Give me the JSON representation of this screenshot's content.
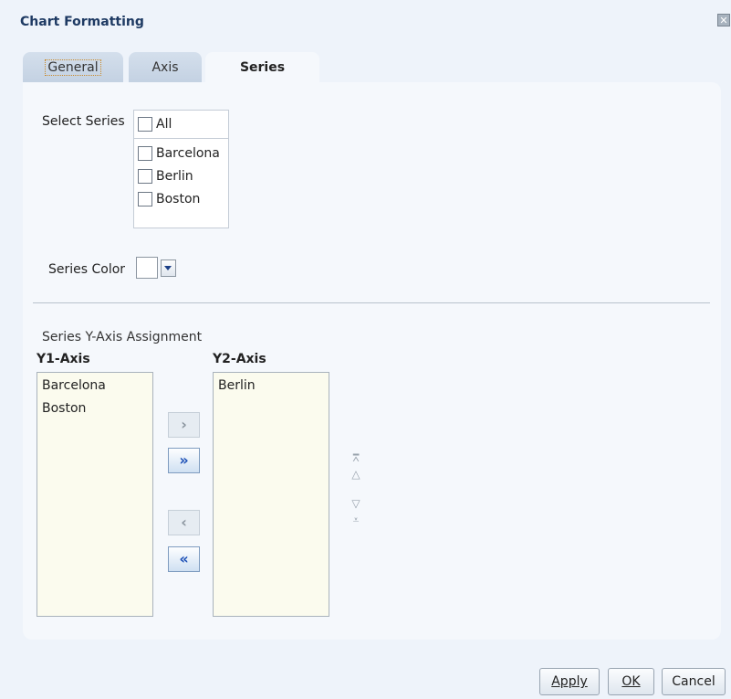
{
  "dialog": {
    "title": "Chart Formatting",
    "close_glyph": "✕"
  },
  "tabs": [
    {
      "label": "General",
      "active": false
    },
    {
      "label": "Axis",
      "active": false
    },
    {
      "label": "Series",
      "active": true
    }
  ],
  "select_series": {
    "label": "Select Series",
    "all_label": "All",
    "items": [
      {
        "label": "Barcelona",
        "checked": false
      },
      {
        "label": "Berlin",
        "checked": false
      },
      {
        "label": "Boston",
        "checked": false
      }
    ]
  },
  "series_color": {
    "label": "Series Color",
    "value": "#ffffff"
  },
  "assignment": {
    "title": "Series Y-Axis Assignment",
    "y1_title": "Y1-Axis",
    "y2_title": "Y2-Axis",
    "y1_items": [
      "Barcelona",
      "Boston"
    ],
    "y2_items": [
      "Berlin"
    ]
  },
  "shuttle_glyphs": {
    "move": "›",
    "move_all": "»",
    "remove": "‹",
    "remove_all": "«"
  },
  "order_glyphs": {
    "top": "⩞",
    "up": "△",
    "down": "▽",
    "bottom": "⩡"
  },
  "buttons": {
    "apply": "Apply",
    "ok": "OK",
    "cancel": "Cancel"
  }
}
